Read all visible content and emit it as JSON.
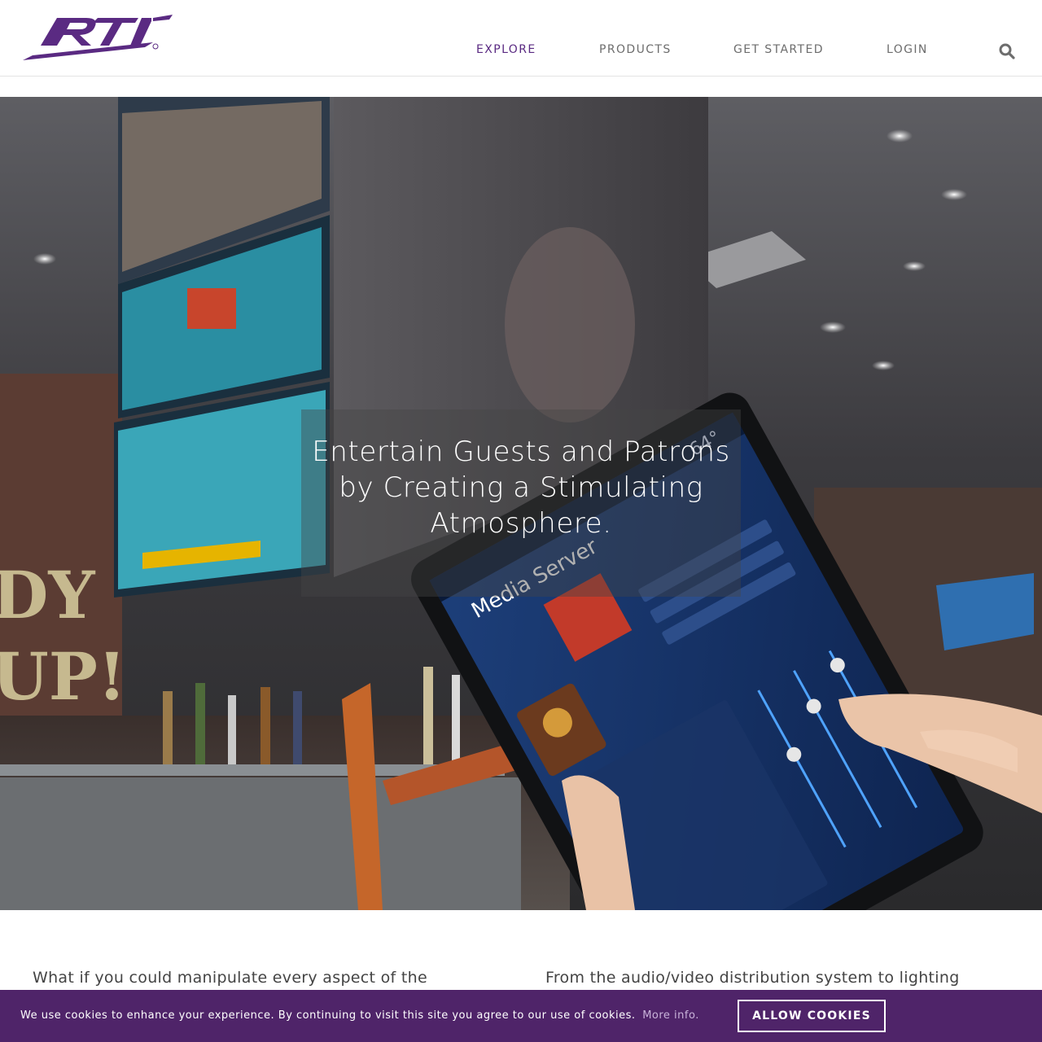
{
  "header": {
    "nav": [
      {
        "label": "EXPLORE",
        "active": true
      },
      {
        "label": "PRODUCTS",
        "active": false
      },
      {
        "label": "GET STARTED",
        "active": false
      },
      {
        "label": "LOGIN",
        "active": false
      }
    ],
    "search_icon": "search-icon",
    "brand_color": "#5a2a82"
  },
  "hero": {
    "caption": "Entertain Guests and Patrons by Creating a Stimulating Atmosphere.",
    "tablet_title": "Media Server",
    "tablet_temp": "64°"
  },
  "intro": {
    "left": "What if you could manipulate every aspect of the",
    "right": "From the audio/video distribution system to lighting"
  },
  "cookie": {
    "text": "We use cookies to enhance your experience. By continuing to visit this site you agree to our use of cookies.",
    "more_link": "More info.",
    "button_label": "ALLOW COOKIES",
    "background": "#4f2469"
  }
}
